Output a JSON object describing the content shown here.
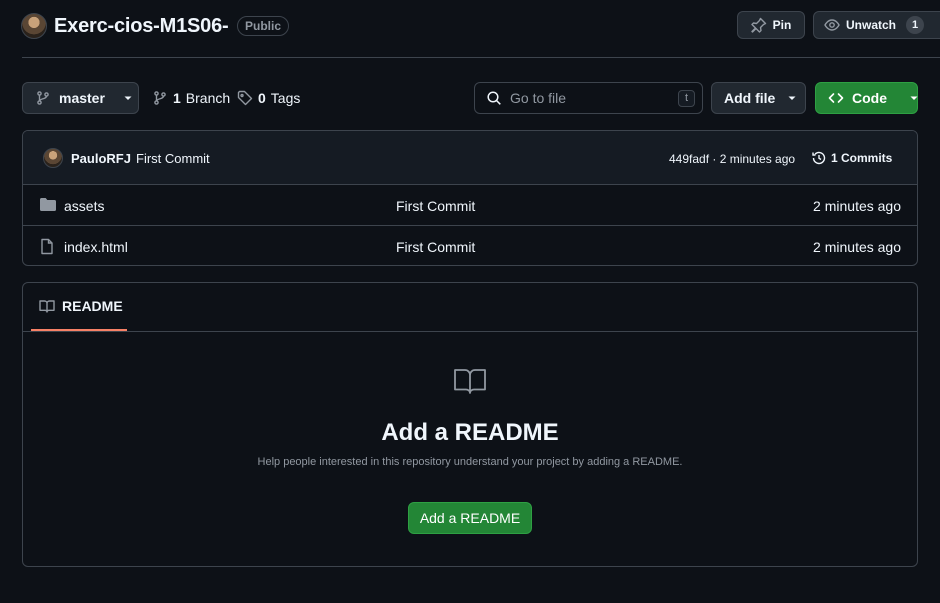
{
  "repo": {
    "name": "Exerc-cios-M1S06-",
    "visibility": "Public"
  },
  "header_actions": {
    "pin_label": "Pin",
    "unwatch_label": "Unwatch",
    "watch_count": "1"
  },
  "toolbar": {
    "branch": "master",
    "branches_count": "1",
    "branches_label": "Branch",
    "tags_count": "0",
    "tags_label": "Tags",
    "goto_placeholder": "Go to file",
    "goto_shortcut": "t",
    "add_file_label": "Add file",
    "code_label": "Code"
  },
  "latest_commit": {
    "author": "PauloRFJ",
    "message": "First Commit",
    "hash_time": "449fadf · 2 minutes ago",
    "commits_count_label": "1 Commits"
  },
  "files": [
    {
      "type": "folder",
      "name": "assets",
      "message": "First Commit",
      "time": "2 minutes ago"
    },
    {
      "type": "file",
      "name": "index.html",
      "message": "First Commit",
      "time": "2 minutes ago"
    }
  ],
  "readme": {
    "tab_label": "README",
    "empty_title": "Add a README",
    "empty_desc": "Help people interested in this repository understand your project by adding a README.",
    "button_label": "Add a README"
  },
  "colors": {
    "background": "#0d1117",
    "border": "#3d444d",
    "primary_button": "#238636",
    "tab_underline": "#f78166"
  }
}
